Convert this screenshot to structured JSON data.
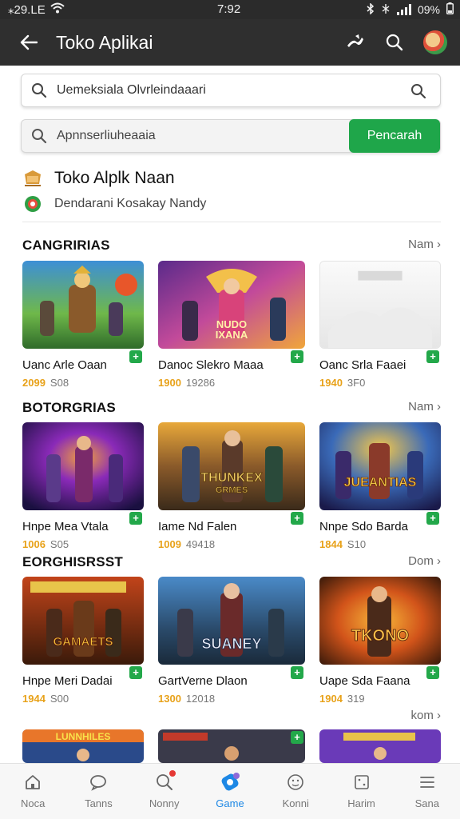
{
  "status": {
    "left_text": "⁎29.LE",
    "time": "7:92",
    "battery": "09%"
  },
  "header": {
    "title": "Toko Aplikai"
  },
  "search1": {
    "text": "Uemeksiala Olvrleindaaari"
  },
  "search2": {
    "text": "Apnnserliuheaaia",
    "button": "Pencarah"
  },
  "store": {
    "name": "Toko Alplk Naan",
    "subtitle": "Dendarani Kosakay Nandy"
  },
  "sections": [
    {
      "title": "CANGRIRIAS",
      "more": "Nam",
      "items": [
        {
          "title": "Uanc Arle Oaan",
          "price": "2099",
          "sub": "S08",
          "badge": "+"
        },
        {
          "title": "Danoc Slekro Maaa",
          "price": "1900",
          "sub": "19286",
          "badge": "+"
        },
        {
          "title": "Oanc Srla Faaei",
          "price": "1940",
          "sub": "3F0",
          "badge": "+"
        }
      ]
    },
    {
      "title": "BOTORGRIAS",
      "more": "Nam",
      "items": [
        {
          "title": "Hnpe Mea Vtala",
          "price": "1006",
          "sub": "S05",
          "badge": "+"
        },
        {
          "title": "Iame Nd Falen",
          "price": "1009",
          "sub": "49418",
          "badge": "+"
        },
        {
          "title": "Nnpe Sdo Barda",
          "price": "1844",
          "sub": "S10",
          "badge": "+"
        }
      ]
    },
    {
      "title": "EORGHISRSST",
      "more": "Dom",
      "items": [
        {
          "title": "Hnpe Meri Dadai",
          "price": "1944",
          "sub": "S00",
          "badge": "+"
        },
        {
          "title": "GartVerne Dlaon",
          "price": "1300",
          "sub": "12018",
          "badge": "+"
        },
        {
          "title": "Uape Sda Faana",
          "price": "1904",
          "sub": "319",
          "badge": "+"
        }
      ]
    }
  ],
  "fourth_more": "kom",
  "thumb_texts": {
    "c2": "NUDO\nIXANA",
    "d2": "THUNKEX\nGRMES",
    "d3": "JUEANTIAS",
    "e1": "GAMAETS",
    "e2": "SUANEY",
    "e3": "TKONO",
    "f1": "LUNNHILES"
  },
  "nav": [
    {
      "label": "Noca",
      "icon": "home-icon"
    },
    {
      "label": "Tanns",
      "icon": "chat-icon"
    },
    {
      "label": "Nonny",
      "icon": "search-icon"
    },
    {
      "label": "Game",
      "icon": "gamepad-icon",
      "active": true
    },
    {
      "label": "Konni",
      "icon": "face-icon"
    },
    {
      "label": "Harim",
      "icon": "dice-icon"
    },
    {
      "label": "Sana",
      "icon": "menu-icon"
    }
  ],
  "colors": {
    "accent_green": "#1fa64a",
    "active_blue": "#1e88e5",
    "price_orange": "#e8a21a"
  }
}
